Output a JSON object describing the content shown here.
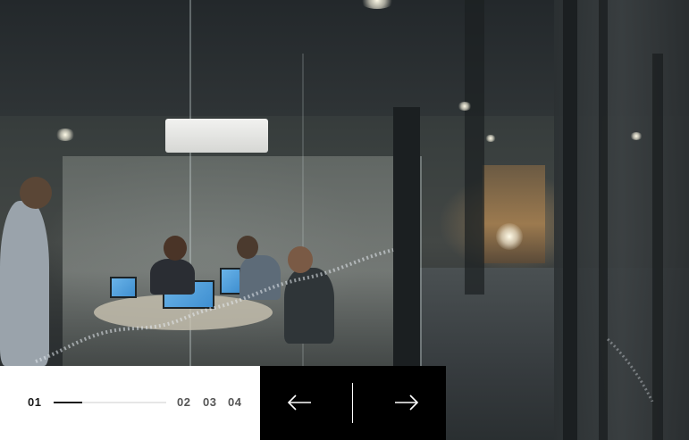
{
  "slider": {
    "current": "01",
    "pages": [
      "02",
      "03",
      "04"
    ],
    "progress_fraction": 0.25
  },
  "navigation": {
    "prev_icon": "arrow-left-icon",
    "next_icon": "arrow-right-icon"
  },
  "colors": {
    "panel_light": "#ffffff",
    "panel_dark": "#000000",
    "accent_text": "#1a1a1a"
  }
}
